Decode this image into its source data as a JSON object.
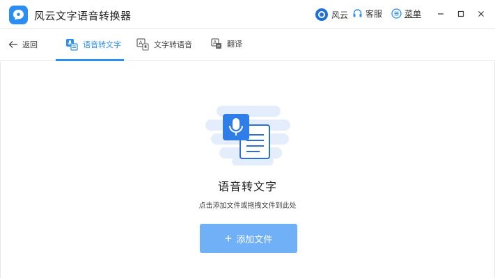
{
  "window": {
    "title": "风云文字语音转换器",
    "brand_label": "风云",
    "service_label": "客服",
    "menu_label": "菜单"
  },
  "tabs": {
    "back_label": "返回",
    "items": [
      {
        "label": "语音转文字",
        "active": true
      },
      {
        "label": "文字转语音",
        "active": false
      },
      {
        "label": "翻译",
        "active": false
      }
    ]
  },
  "main": {
    "heading": "语音转文字",
    "subheading": "点击添加文件或拖拽文件到此处",
    "add_button_label": "添加文件"
  },
  "colors": {
    "accent": "#2b8ef5",
    "button": "#6fb0f7"
  }
}
